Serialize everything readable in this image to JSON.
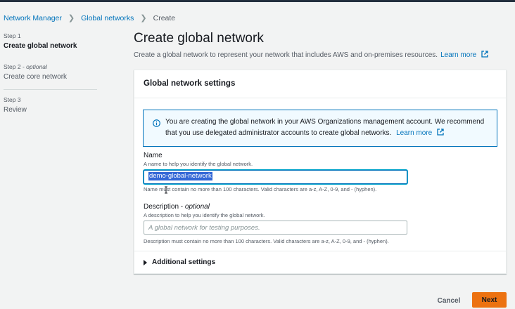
{
  "breadcrumb": {
    "items": [
      "Network Manager",
      "Global networks"
    ],
    "current": "Create"
  },
  "steps": [
    {
      "number": "Step 1",
      "title": "Create global network"
    },
    {
      "number": "Step 2",
      "optional": "optional",
      "title": "Create core network"
    },
    {
      "number": "Step 3",
      "title": "Review"
    }
  ],
  "step2_sep": " - ",
  "page": {
    "title": "Create global network",
    "description": "Create a global network to represent your network that includes AWS and on-premises resources.",
    "learn_more": "Learn more"
  },
  "panel": {
    "title": "Global network settings",
    "alert_text": "You are creating the global network in your AWS Organizations management account. We recommend that you use delegated administrator accounts to create global networks.",
    "alert_learn_more": "Learn more"
  },
  "name_field": {
    "label": "Name",
    "description": "A name to help you identify the global network.",
    "value": "demo-global-network",
    "hint": "Name must contain no more than 100 characters. Valid characters are a-z, A-Z, 0-9, and - (hyphen)."
  },
  "description_field": {
    "label": "Description",
    "optional": "optional",
    "description": "A description to help you identify the global network.",
    "placeholder": "A global network for testing purposes.",
    "hint": "Description must contain no more than 100 characters. Valid characters are a-z, A-Z, 0-9, and - (hyphen)."
  },
  "additional_settings": "Additional settings",
  "actions": {
    "cancel": "Cancel",
    "next": "Next"
  },
  "colors": {
    "link": "#0073bb",
    "primary_button": "#ec7211",
    "info_border": "#0073bb",
    "info_bg": "#f1faff"
  },
  "icons": [
    "chevron-right-icon",
    "external-link-icon",
    "info-icon",
    "caret-right-icon",
    "mouse-cursor-icon"
  ]
}
